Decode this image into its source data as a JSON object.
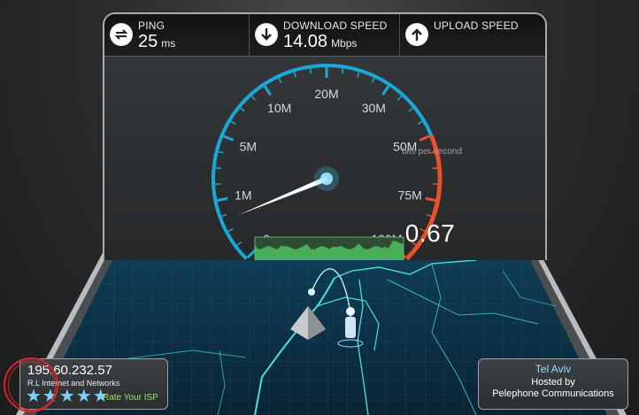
{
  "stats": {
    "ping": {
      "label": "PING",
      "value": "25",
      "unit": "ms",
      "icon": "ping-arrows-icon"
    },
    "download": {
      "label": "DOWNLOAD SPEED",
      "value": "14.08",
      "unit": "Mbps",
      "icon": "download-arrow-icon"
    },
    "upload": {
      "label": "UPLOAD SPEED",
      "value": "",
      "unit": "",
      "icon": "upload-arrow-icon"
    }
  },
  "gauge": {
    "caption": "bits per second",
    "readout": "0.67",
    "current_mbps": 0.67,
    "ticks": [
      "0",
      "1M",
      "5M",
      "10M",
      "20M",
      "30M",
      "50M",
      "75M",
      "100M"
    ],
    "colors": {
      "normal": "#1aa9d6",
      "high": "#e8512c",
      "needle": "#ffffff"
    }
  },
  "isp": {
    "ip": "195.60.232.57",
    "name": "R.L Internet and Networks",
    "rating_stars": 5,
    "rate_label": "Rate Your ISP"
  },
  "server": {
    "city": "Tel Aviv",
    "hosted_label": "Hosted by",
    "host": "Pelephone Communications"
  },
  "colors": {
    "accent": "#1aa9d6",
    "map_line": "#3fd6c6",
    "rate_green": "#9be36b",
    "annotation_red": "#d3262b"
  }
}
